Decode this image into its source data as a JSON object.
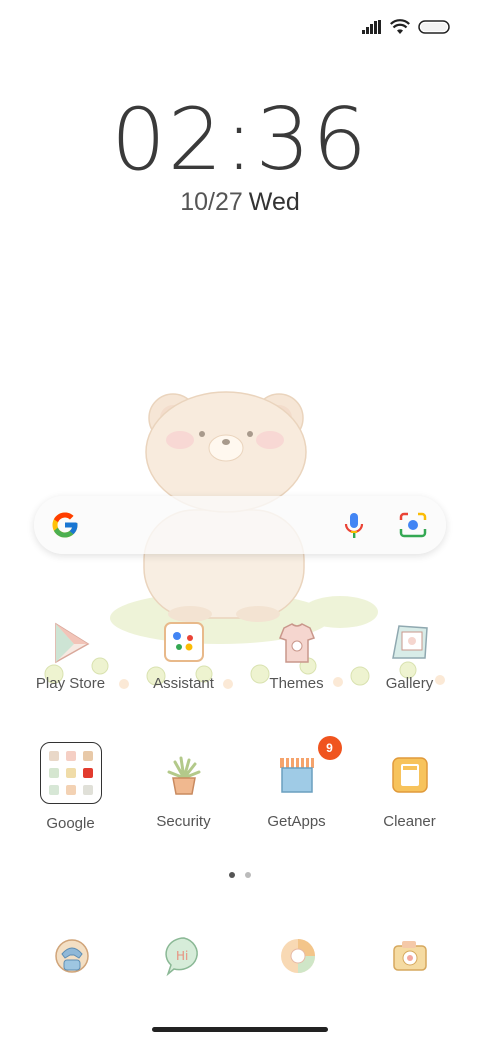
{
  "status_bar": {
    "icons": [
      "signal-icon",
      "wifi-icon",
      "battery-icon"
    ]
  },
  "lockclock": {
    "time": "02:36",
    "date": "10/27",
    "weekday": "Wed"
  },
  "search": {
    "logo": "google-g-icon",
    "mic": "voice-search-icon",
    "lens": "google-lens-icon"
  },
  "apps": [
    {
      "label": "Play Store",
      "icon": "play-store-icon"
    },
    {
      "label": "Assistant",
      "icon": "assistant-icon"
    },
    {
      "label": "Themes",
      "icon": "themes-icon"
    },
    {
      "label": "Gallery",
      "icon": "gallery-icon"
    },
    {
      "label": "Google",
      "icon": "google-folder-icon"
    },
    {
      "label": "Security",
      "icon": "security-icon"
    },
    {
      "label": "GetApps",
      "icon": "getapps-icon",
      "badge": "9"
    },
    {
      "label": "Cleaner",
      "icon": "cleaner-icon"
    }
  ],
  "pages": {
    "count": 2,
    "active": 1
  },
  "dock": [
    "phone-icon",
    "messages-icon",
    "browser-icon",
    "camera-icon"
  ],
  "colors": {
    "badge": "#f0541e",
    "text": "#555555"
  }
}
